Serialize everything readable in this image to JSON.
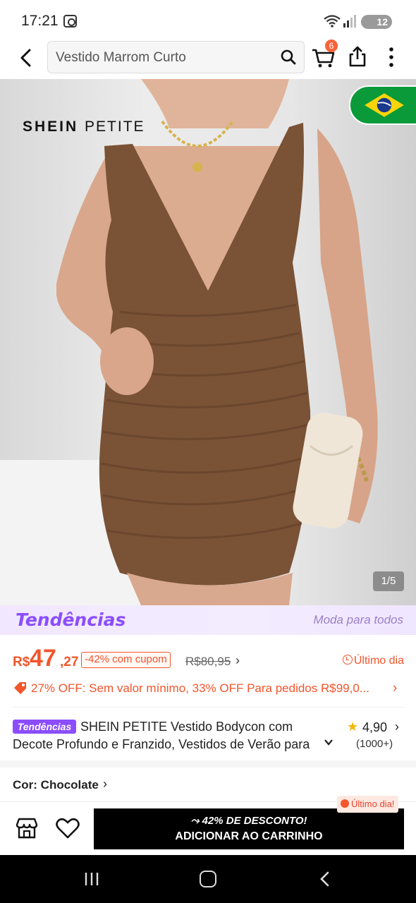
{
  "status_bar": {
    "time": "17:21",
    "battery": "12"
  },
  "top_nav": {
    "search_value": "Vestido Marrom Curto",
    "cart_count": "6"
  },
  "gallery": {
    "brand_logo_main": "SHEIN",
    "brand_logo_sub": "PETITE",
    "counter": "1/5"
  },
  "trends_banner": {
    "logo": "Tendências",
    "slogan": "Moda para todos"
  },
  "price": {
    "currency": "R$",
    "integer": "47",
    "decimal": ",27",
    "coupon": "-42% com cupom",
    "old_price": "R$80,95",
    "last_day": "Último dia"
  },
  "promo": {
    "text": "27% OFF: Sem valor mínimo,  33% OFF Para pedidos R$99,0..."
  },
  "product": {
    "trends_chip": "Tendências",
    "title": "SHEIN PETITE Vestido Bodycon com Decote Profundo e Franzido, Vestidos de Verão para Mulheres",
    "rating": "4,90",
    "rating_count": "(1000+)"
  },
  "color": {
    "label": "Cor: Chocolate"
  },
  "action_bar": {
    "discount": "42% DE DESCONTO!",
    "add_to_cart": "ADICIONAR AO CARRINHO",
    "last_day_bubble": "Último dia!"
  },
  "colors": {
    "accent": "#f2552c",
    "trends_purple": "#8b4dff",
    "rating_star": "#f7b500",
    "dress_brown": "#7a5236"
  }
}
